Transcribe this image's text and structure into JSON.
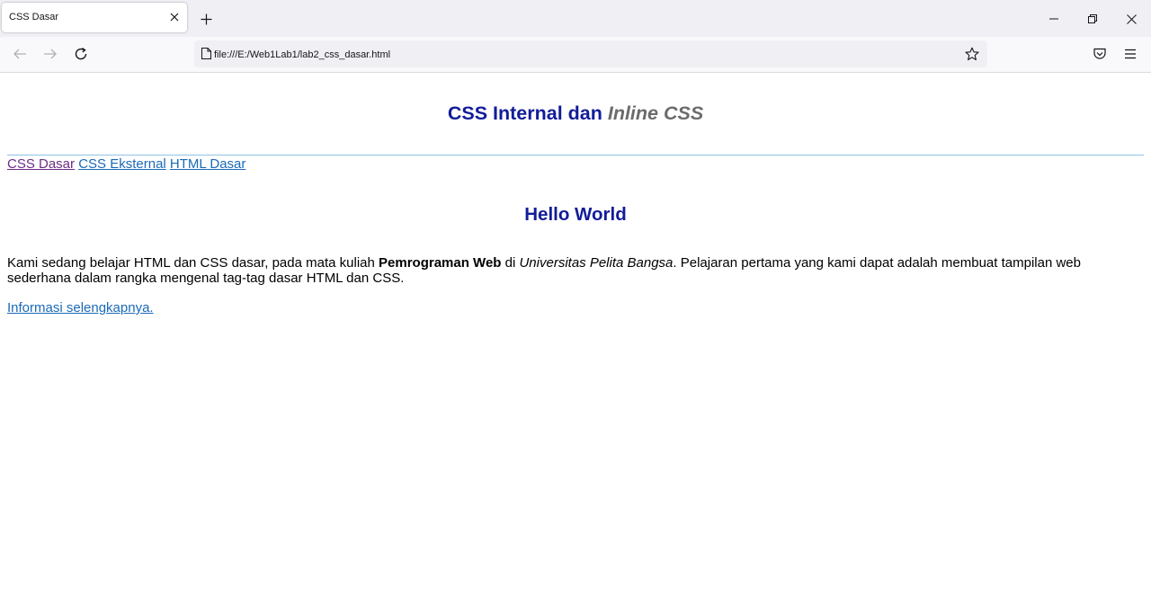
{
  "browser": {
    "tab_title": "CSS Dasar",
    "url": "file:///E:/Web1Lab1/lab2_css_dasar.html"
  },
  "page": {
    "heading_main": "CSS Internal dan ",
    "heading_inline": "Inline CSS",
    "nav_links": [
      "CSS Dasar",
      "CSS Eksternal",
      "HTML Dasar"
    ],
    "subheading": "Hello World",
    "paragraph": {
      "part1": "Kami sedang belajar HTML dan CSS dasar, pada mata kuliah ",
      "bold": "Pemrograman Web",
      "part2": " di ",
      "italic": "Universitas Pelita Bangsa",
      "part3": ". Pelajaran pertama yang kami dapat adalah membuat tampilan web sederhana dalam rangka mengenal tag-tag dasar HTML dan CSS."
    },
    "more_link": "Informasi selengkapnya."
  },
  "colors": {
    "heading": "#111c99",
    "inline_text": "#6b6b6b",
    "link": "#1a6ab7",
    "visited_link": "#6c2d86",
    "hr": "#8fc2e8"
  }
}
